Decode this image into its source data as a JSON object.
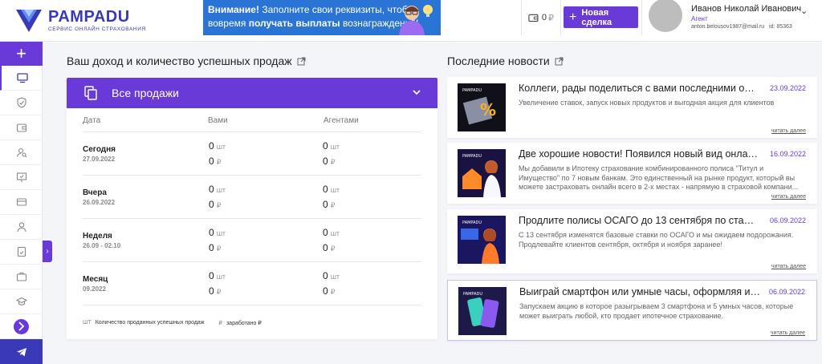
{
  "brand": {
    "name": "PAMPADU",
    "tagline": "СЕРВИС ОНЛАЙН СТРАХОВАНИЯ"
  },
  "banner": {
    "prefix": "Внимание!",
    "line1": " Заполните свои реквизиты, чтобы",
    "line2a": "вовремя ",
    "line2b": "получать выплаты",
    "line2c": " вознаграждений!"
  },
  "wallet": {
    "amount": "0",
    "currency": "₽"
  },
  "new_deal": {
    "label": "Новая сделка"
  },
  "user": {
    "name": "Иванов Николай Иванович",
    "role": "Агент",
    "email": "anton.belousov1987@mail.ru",
    "id": "id: 85363"
  },
  "income": {
    "title": "Ваш доход и количество успешных продаж",
    "filter_label": "Все продажи",
    "columns": [
      "Дата",
      "Вами",
      "Агентами"
    ],
    "rows": [
      {
        "period": "Сегодня",
        "date": "27.09.2022",
        "mine_count": "0",
        "mine_sum": "0",
        "agents_count": "0",
        "agents_sum": "0"
      },
      {
        "period": "Вчера",
        "date": "26.09.2022",
        "mine_count": "0",
        "mine_sum": "0",
        "agents_count": "0",
        "agents_sum": "0"
      },
      {
        "period": "Неделя",
        "date": "26.09 - 02.10",
        "mine_count": "0",
        "mine_sum": "0",
        "agents_count": "0",
        "agents_sum": "0"
      },
      {
        "period": "Месяц",
        "date": "09.2022",
        "mine_count": "0",
        "mine_sum": "0",
        "agents_count": "0",
        "agents_sum": "0"
      }
    ],
    "unit_count": "шт",
    "unit_money": "₽",
    "legend": {
      "count_key": "ШТ",
      "count_label": "Количество проданных успешных продаж",
      "money_key": "₽",
      "money_label": "заработано ₽"
    }
  },
  "news": {
    "title": "Последние новости",
    "items": [
      {
        "title": "Коллеги, рады поделиться с вами последними обн...",
        "date": "23.09.2022",
        "text": "Увеличение ставок, запуск новых продуктов и выгодная акция для клиентов",
        "more": "читать далее"
      },
      {
        "title": "Две хорошие новости! Появился новый вид онлайн...",
        "date": "16.09.2022",
        "text": "Мы добавили в Ипотеку страхование комбинированного полиса \"Титул и Имущество\" по 7 новым банкам. Это единственный на рынке продукт, который вы можете застраховать онлайн всего в 2-х местах - напрямую в страховой компани...",
        "more": "читать далее"
      },
      {
        "title": "Продлите полисы ОСАГО до 13 сентября по старым ...",
        "date": "06.09.2022",
        "text": "С 13 сентября изменятся базовые ставки по ОСАГО и мы ожидаем подорожания. Продлевайте клиентов сентября, октября и ноября заранее!",
        "more": "читать далее"
      },
      {
        "title": "Выиграй смартфон или умные часы, оформляя ипо...",
        "date": "06.09.2022",
        "text": "Запускаем акцию в которое разыгрываем 3 смартфона и 5 умных часов, которые может выиграть любой, кто продает ипотечное страхование.",
        "more": "читать далее"
      }
    ]
  }
}
